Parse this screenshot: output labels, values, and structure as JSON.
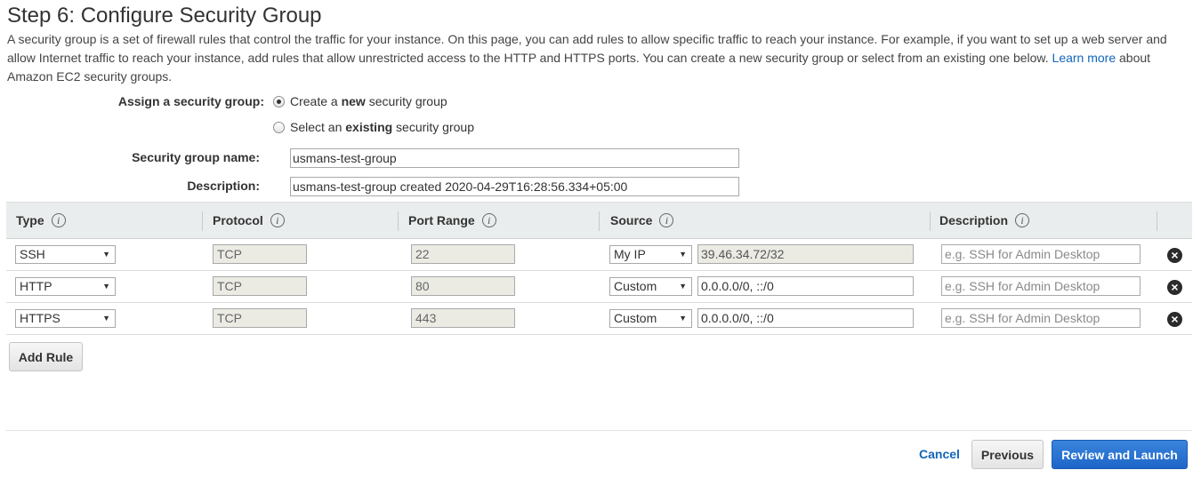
{
  "page": {
    "title": "Step 6: Configure Security Group",
    "intro_part1": "A security group is a set of firewall rules that control the traffic for your instance. On this page, you can add rules to allow specific traffic to reach your instance. For example, if you want to set up a web server and allow Internet traffic to reach your instance, add rules that allow unrestricted access to the HTTP and HTTPS ports. You can create a new security group or select from an existing one below.",
    "learn_more": "Learn more",
    "intro_part2": "about Amazon EC2 security groups."
  },
  "form": {
    "assign_label": "Assign a security group:",
    "option_new": {
      "prefix": "Create a ",
      "bold": "new",
      "suffix": " security group",
      "selected": true
    },
    "option_existing": {
      "prefix": "Select an ",
      "bold": "existing",
      "suffix": " security group",
      "selected": false
    },
    "name_label": "Security group name:",
    "name_value": "usmans-test-group",
    "description_label": "Description:",
    "description_value": "usmans-test-group created 2020-04-29T16:28:56.334+05:00"
  },
  "table": {
    "headers": [
      "Type",
      "Protocol",
      "Port Range",
      "Source",
      "Description"
    ],
    "info_icon_text": "i",
    "remove_icon_text": "×",
    "rows": [
      {
        "type": "SSH",
        "protocol": "TCP",
        "port": "22",
        "source_type": "My IP",
        "source": "39.46.34.72/32",
        "description_placeholder": "e.g. SSH for Admin Desktop"
      },
      {
        "type": "HTTP",
        "protocol": "TCP",
        "port": "80",
        "source_type": "Custom",
        "source": "0.0.0.0/0, ::/0",
        "description_placeholder": "e.g. SSH for Admin Desktop"
      },
      {
        "type": "HTTPS",
        "protocol": "TCP",
        "port": "443",
        "source_type": "Custom",
        "source": "0.0.0.0/0, ::/0",
        "description_placeholder": "e.g. SSH for Admin Desktop"
      }
    ]
  },
  "actions": {
    "add_rule": "Add Rule",
    "cancel": "Cancel",
    "previous": "Previous",
    "review_launch": "Review and Launch",
    "dropdown_arrow": "▼"
  },
  "colors": {
    "link": "#1166bb",
    "primary_button": "#1d66c8",
    "header_bg": "#eaeded"
  }
}
